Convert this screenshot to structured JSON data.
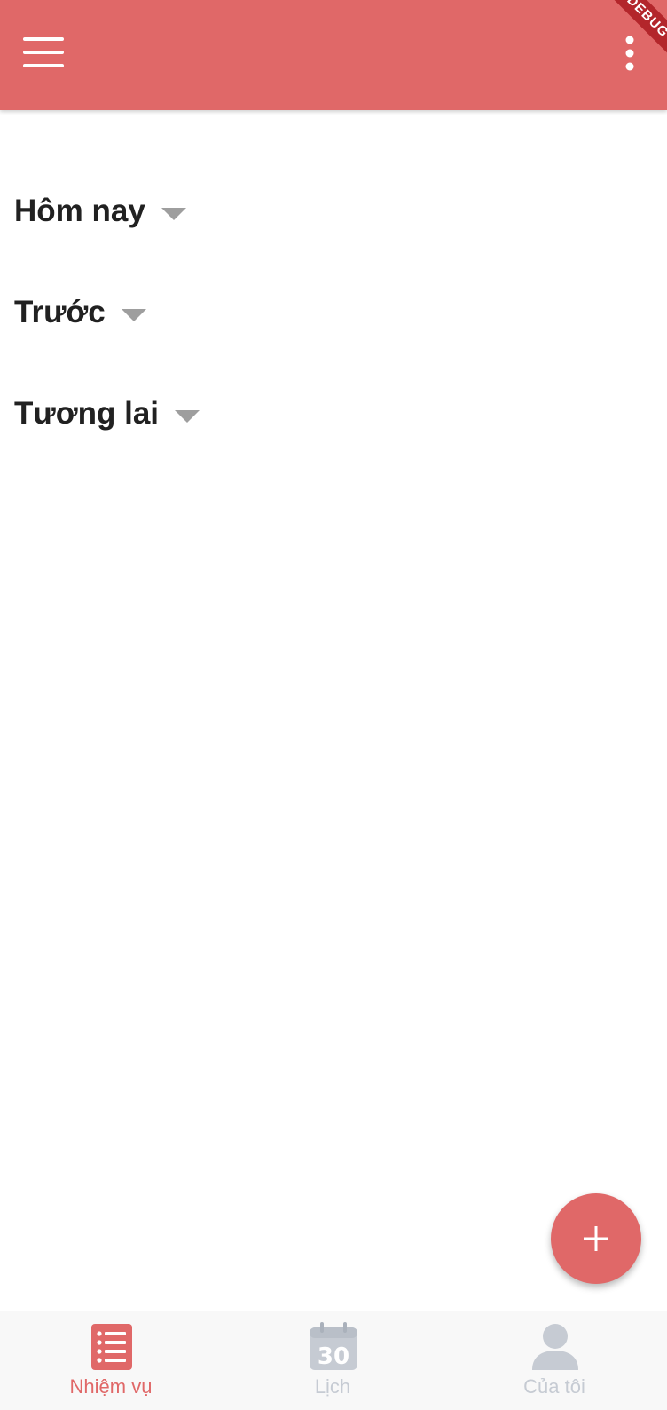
{
  "app_bar": {
    "menu_icon": "hamburger-menu-icon",
    "more_icon": "more-vertical-icon",
    "debug_banner": "DEBUG"
  },
  "sections": [
    {
      "title": "Hôm nay"
    },
    {
      "title": "Trước"
    },
    {
      "title": "Tương lai"
    }
  ],
  "fab": {
    "icon": "plus-icon"
  },
  "bottom_nav": {
    "items": [
      {
        "label": "Nhiệm vụ",
        "icon": "task-list-icon",
        "active": true
      },
      {
        "label": "Lịch",
        "icon": "calendar-icon",
        "calendar_day": "30",
        "active": false
      },
      {
        "label": "Của tôi",
        "icon": "user-profile-icon",
        "active": false
      }
    ]
  },
  "colors": {
    "primary": "#e06868",
    "inactive": "#c6cbd3",
    "text": "#212121",
    "caret": "#9e9e9e",
    "debug_banner": "#b3262b"
  }
}
